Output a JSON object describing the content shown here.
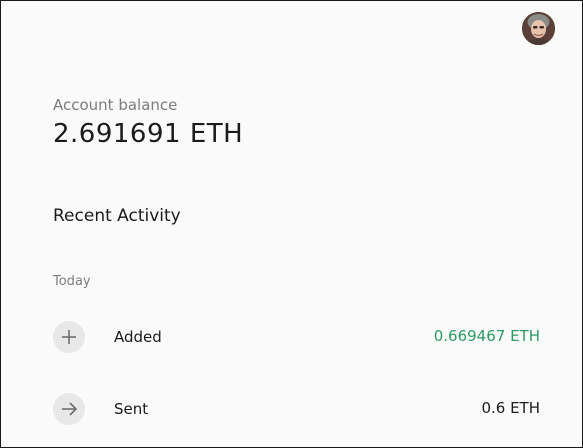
{
  "header": {
    "avatar_icon": "user-avatar-photo"
  },
  "account": {
    "balance_label": "Account balance",
    "balance_value": "2.691691 ETH"
  },
  "activity": {
    "title": "Recent Activity",
    "groups": [
      {
        "label": "Today",
        "items": [
          {
            "icon": "plus-icon",
            "label": "Added",
            "amount": "0.669467 ETH",
            "amount_color": "#2c9a62"
          },
          {
            "icon": "arrow-right-icon",
            "label": "Sent",
            "amount": "0.6 ETH",
            "amount_color": "#1b1b1b"
          }
        ]
      }
    ]
  }
}
